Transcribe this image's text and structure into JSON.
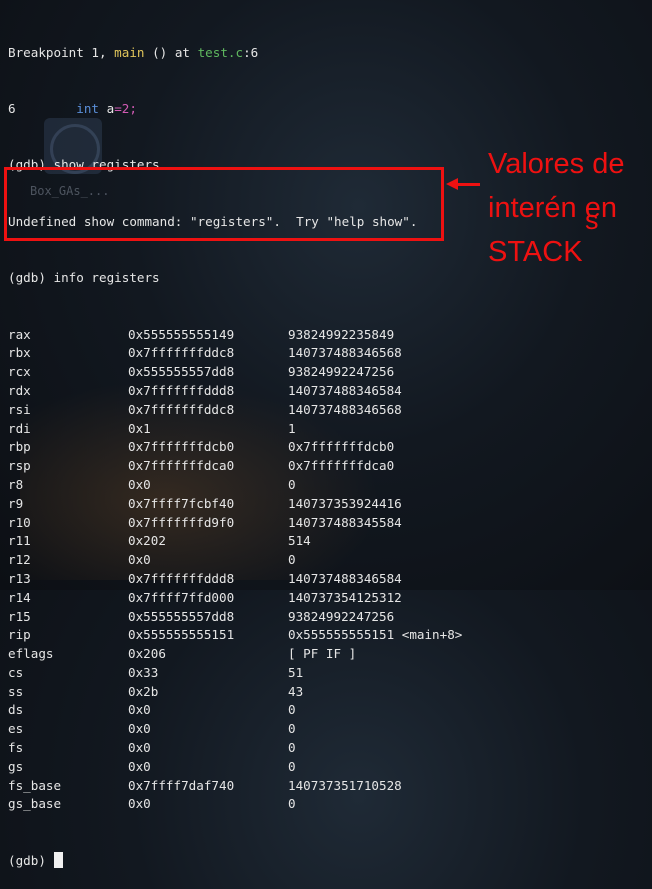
{
  "header": {
    "breakpoint_prefix": "Breakpoint 1, ",
    "breakpoint_func": "main",
    "breakpoint_mid": " () at ",
    "breakpoint_file": "test.c",
    "breakpoint_suffix": ":6",
    "source_lineno": "6",
    "source_indent": "        ",
    "source_keyword": "int",
    "source_var": " a",
    "source_op": "=",
    "source_num": "2",
    "source_semicolon": ";"
  },
  "commands": [
    "(gdb) show registers",
    "Undefined show command: \"registers\".  Try \"help show\".",
    "(gdb) info registers"
  ],
  "registers": [
    {
      "name": "rax",
      "hex": "0x555555555149",
      "value": "93824992235849"
    },
    {
      "name": "rbx",
      "hex": "0x7fffffffddc8",
      "value": "140737488346568"
    },
    {
      "name": "rcx",
      "hex": "0x555555557dd8",
      "value": "93824992247256"
    },
    {
      "name": "rdx",
      "hex": "0x7fffffffddd8",
      "value": "140737488346584"
    },
    {
      "name": "rsi",
      "hex": "0x7fffffffddc8",
      "value": "140737488346568"
    },
    {
      "name": "rdi",
      "hex": "0x1",
      "value": "1"
    },
    {
      "name": "rbp",
      "hex": "0x7fffffffdcb0",
      "value": "0x7fffffffdcb0"
    },
    {
      "name": "rsp",
      "hex": "0x7fffffffdca0",
      "value": "0x7fffffffdca0"
    },
    {
      "name": "r8",
      "hex": "0x0",
      "value": "0"
    },
    {
      "name": "r9",
      "hex": "0x7ffff7fcbf40",
      "value": "140737353924416"
    },
    {
      "name": "r10",
      "hex": "0x7fffffffd9f0",
      "value": "140737488345584"
    },
    {
      "name": "r11",
      "hex": "0x202",
      "value": "514"
    },
    {
      "name": "r12",
      "hex": "0x0",
      "value": "0"
    },
    {
      "name": "r13",
      "hex": "0x7fffffffddd8",
      "value": "140737488346584"
    },
    {
      "name": "r14",
      "hex": "0x7ffff7ffd000",
      "value": "140737354125312"
    },
    {
      "name": "r15",
      "hex": "0x555555557dd8",
      "value": "93824992247256"
    },
    {
      "name": "rip",
      "hex": "0x555555555151",
      "value": "0x555555555151 <main+8>"
    },
    {
      "name": "eflags",
      "hex": "0x206",
      "value": "[ PF IF ]"
    },
    {
      "name": "cs",
      "hex": "0x33",
      "value": "51"
    },
    {
      "name": "ss",
      "hex": "0x2b",
      "value": "43"
    },
    {
      "name": "ds",
      "hex": "0x0",
      "value": "0"
    },
    {
      "name": "es",
      "hex": "0x0",
      "value": "0"
    },
    {
      "name": "fs",
      "hex": "0x0",
      "value": "0"
    },
    {
      "name": "gs",
      "hex": "0x0",
      "value": "0"
    },
    {
      "name": "fs_base",
      "hex": "0x7ffff7daf740",
      "value": "140737351710528"
    },
    {
      "name": "gs_base",
      "hex": "0x0",
      "value": "0"
    }
  ],
  "prompt": "(gdb) ",
  "background": {
    "icon_label": "Box_GAs_..."
  },
  "annotation": {
    "line1": "Valores de",
    "line2_a": "interé",
    "line2_strike": "n",
    "line2_b": " en",
    "line2_insert": "s",
    "line3": "STACK",
    "color": "#ee1111"
  },
  "colors": {
    "background": "#121820",
    "text": "#e6e6e6",
    "function": "#e0c45a",
    "file": "#5fb85f",
    "keyword": "#5a8ed8",
    "number": "#d15ab4"
  }
}
